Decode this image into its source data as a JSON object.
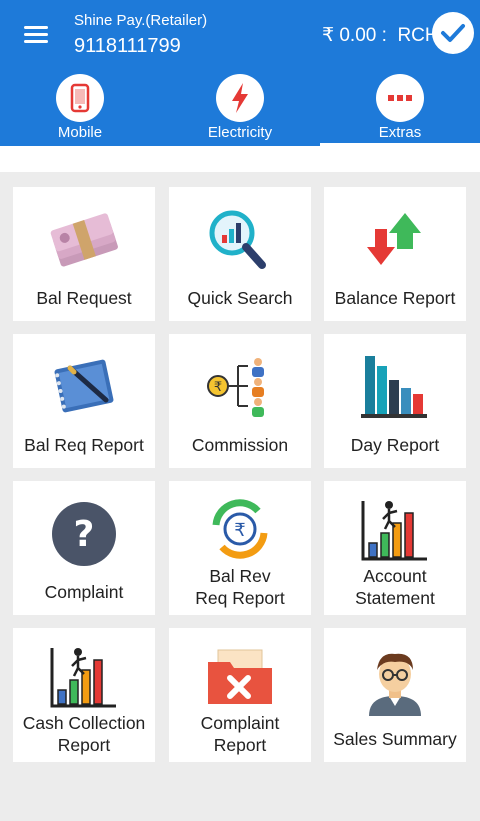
{
  "header": {
    "shop_name": "Shine Pay.(Retailer)",
    "mobile_number": "9118111799",
    "balance": "₹ 0.00 :  RCH",
    "colors": {
      "primary": "#1e7ad9",
      "accent_red": "#e53935",
      "check_blue": "#1e7ad9"
    }
  },
  "tabs": [
    {
      "label": "Mobile",
      "icon": "mobile-phone-icon",
      "active": false
    },
    {
      "label": "Electricity",
      "icon": "lightning-icon",
      "active": false
    },
    {
      "label": "Extras",
      "icon": "more-dots-icon",
      "active": true
    }
  ],
  "grid": [
    {
      "line1": "Bal Request",
      "line2": "",
      "icon": "money-bundle-icon"
    },
    {
      "line1": "Quick Search",
      "line2": "",
      "icon": "chart-magnifier-icon"
    },
    {
      "line1": "Balance Report",
      "line2": "",
      "icon": "up-down-arrows-icon"
    },
    {
      "line1": "Bal Req Report",
      "line2": "",
      "icon": "notebook-pen-icon"
    },
    {
      "line1": "Commission",
      "line2": "",
      "icon": "rupee-network-icon"
    },
    {
      "line1": "Day Report",
      "line2": "",
      "icon": "bar-chart-icon"
    },
    {
      "line1": "Complaint",
      "line2": "",
      "icon": "question-circle-icon"
    },
    {
      "line1": "Bal Rev",
      "line2": "Req Report",
      "icon": "rupee-refresh-icon"
    },
    {
      "line1": "Account",
      "line2": "Statement",
      "icon": "growth-climber-icon"
    },
    {
      "line1": "Cash Collection",
      "line2": "Report",
      "icon": "growth-climber-icon"
    },
    {
      "line1": "Complaint",
      "line2": "Report",
      "icon": "folder-x-icon"
    },
    {
      "line1": "Sales Summary",
      "line2": "",
      "icon": "person-glasses-icon"
    }
  ]
}
